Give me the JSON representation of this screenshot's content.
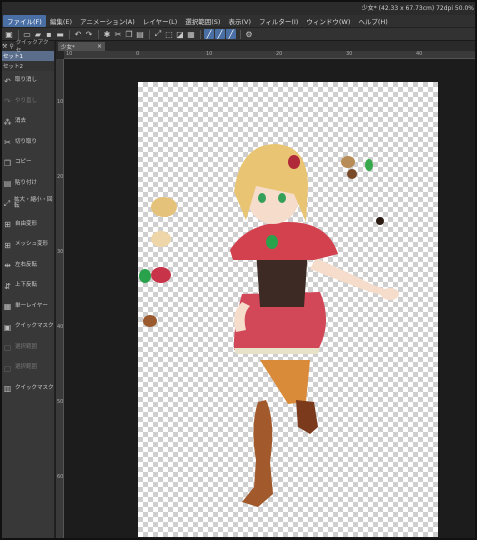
{
  "window": {
    "doc_info": "少女* (42.33 x 67.73cm) 72dpi 50.0%"
  },
  "menus": [
    "ファイル(F)",
    "編集(E)",
    "アニメーション(A)",
    "レイヤー(L)",
    "選択範囲(S)",
    "表示(V)",
    "フィルター(I)",
    "ウィンドウ(W)",
    "ヘルプ(H)"
  ],
  "panel": {
    "title": "クイックアクセ",
    "sets": [
      "セット1",
      "セット2"
    ],
    "items": [
      {
        "icon": "undo-icon",
        "glyph": "↶",
        "label": "取り消し",
        "enabled": true
      },
      {
        "icon": "redo-icon",
        "glyph": "↷",
        "label": "やり直し",
        "enabled": false
      },
      {
        "icon": "erase-icon",
        "glyph": "⁂",
        "label": "消去",
        "enabled": true
      },
      {
        "icon": "cut-icon",
        "glyph": "✂",
        "label": "切り取り",
        "enabled": true
      },
      {
        "icon": "copy-icon",
        "glyph": "❐",
        "label": "コピー",
        "enabled": true
      },
      {
        "icon": "paste-icon",
        "glyph": "▤",
        "label": "貼り付け",
        "enabled": true
      },
      {
        "icon": "scale-rotate-icon",
        "glyph": "⤢",
        "label": "拡大・縮小・回転",
        "enabled": true
      },
      {
        "icon": "free-transform-icon",
        "glyph": "⊞",
        "label": "自由変形",
        "enabled": true
      },
      {
        "icon": "mesh-transform-icon",
        "glyph": "⊞",
        "label": "メッシュ変形",
        "enabled": true
      },
      {
        "icon": "flip-horizontal-icon",
        "glyph": "⇹",
        "label": "左右反転",
        "enabled": true
      },
      {
        "icon": "flip-vertical-icon",
        "glyph": "⇵",
        "label": "上下反転",
        "enabled": true
      },
      {
        "icon": "single-layer-icon",
        "glyph": "▦",
        "label": "単一レイヤー",
        "enabled": true
      },
      {
        "icon": "quick-mask-icon",
        "glyph": "▣",
        "label": "クイックマスク",
        "enabled": true
      },
      {
        "icon": "disabled-action-1-icon",
        "glyph": "▢",
        "label": "選択範囲",
        "enabled": false
      },
      {
        "icon": "disabled-action-2-icon",
        "glyph": "▢",
        "label": "選択範囲",
        "enabled": false
      },
      {
        "icon": "quick-mask-2-icon",
        "glyph": "▥",
        "label": "クイックマスク",
        "enabled": true
      }
    ]
  },
  "document": {
    "tab": "少女*",
    "tab_close": "×"
  },
  "ruler": {
    "h_labels": [
      "10",
      "0",
      "10",
      "20",
      "30",
      "40",
      "50"
    ],
    "v_labels": [
      "10",
      "20",
      "30",
      "40",
      "50",
      "60"
    ]
  }
}
